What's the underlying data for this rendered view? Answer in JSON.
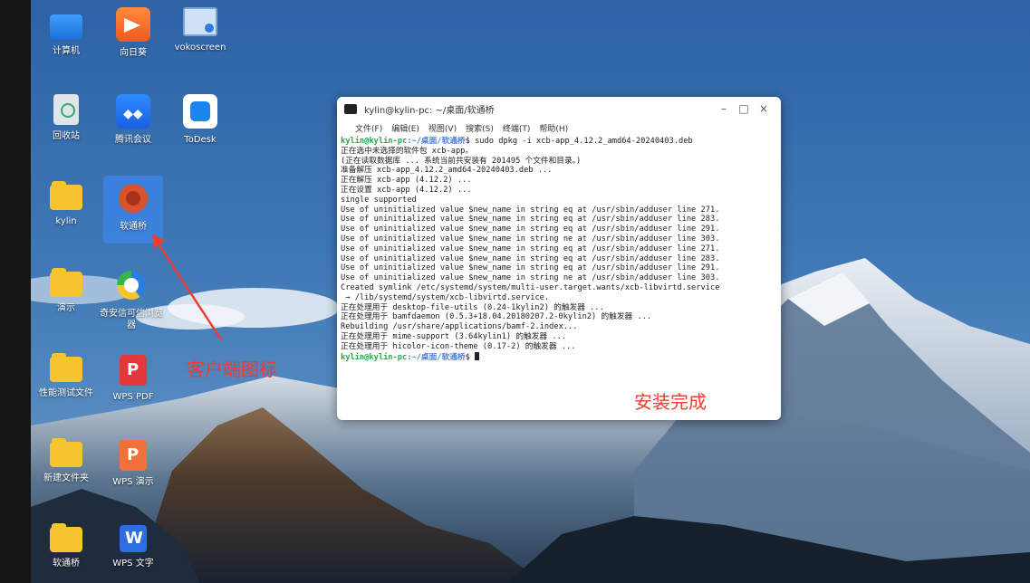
{
  "desktop": {
    "icons": [
      {
        "label": "计算机",
        "icon": "computer-icon"
      },
      {
        "label": "向日葵",
        "icon": "sunflower-icon"
      },
      {
        "label": "vokoscreen",
        "icon": "vokoscreen-icon"
      },
      {
        "label": "回收站",
        "icon": "trash-icon"
      },
      {
        "label": "腾讯会议",
        "icon": "tencent-meeting-icon"
      },
      {
        "label": "ToDesk",
        "icon": "todesk-icon"
      },
      {
        "label": "kylin",
        "icon": "folder-icon"
      },
      {
        "label": "软通桥",
        "icon": "ruantongqiao-icon"
      },
      {
        "label": "演示",
        "icon": "folder-icon"
      },
      {
        "label": "奇安信可信浏览器",
        "icon": "browser-icon"
      },
      {
        "label": "性能测试文件",
        "icon": "folder-icon"
      },
      {
        "label": "WPS PDF",
        "icon": "wps-pdf-icon"
      },
      {
        "label": "新建文件夹",
        "icon": "folder-icon"
      },
      {
        "label": "WPS 演示",
        "icon": "wps-presentation-icon"
      },
      {
        "label": "软通桥",
        "icon": "folder-icon"
      },
      {
        "label": "WPS 文字",
        "icon": "wps-writer-icon"
      }
    ],
    "colors": {
      "folder": "#f6c42e",
      "selection": "#3c8cff",
      "annotation": "#f23a2e"
    }
  },
  "annotations": {
    "client_icon": "客户端图标",
    "install_done": "安装完成"
  },
  "terminal": {
    "title": "kylin@kylin-pc: ~/桌面/软通桥",
    "controls": {
      "minimize": "–",
      "maximize": "□",
      "close": "×"
    },
    "menu": [
      "文件(F)",
      "编辑(E)",
      "视图(V)",
      "搜索(S)",
      "终端(T)",
      "帮助(H)"
    ],
    "prompt_user": "kylin@kylin-pc",
    "prompt_path": ":~/桌面/软通桥",
    "prompt_symbol": "$ ",
    "command": "sudo dpkg -i xcb-app_4.12.2_amd64-20240403.deb",
    "output": [
      "正在选中未选择的软件包 xcb-app。",
      "(正在读取数据库 ... 系统当前共安装有 201495 个文件和目录。)",
      "准备解压 xcb-app_4.12.2_amd64-20240403.deb ...",
      "正在解压 xcb-app (4.12.2) ...",
      "正在设置 xcb-app (4.12.2) ...",
      "single supported",
      "Use of uninitialized value $new_name in string eq at /usr/sbin/adduser line 271.",
      "Use of uninitialized value $new_name in string eq at /usr/sbin/adduser line 283.",
      "Use of uninitialized value $new_name in string eq at /usr/sbin/adduser line 291.",
      "Use of uninitialized value $new_name in string ne at /usr/sbin/adduser line 303.",
      "Use of uninitialized value $new_name in string eq at /usr/sbin/adduser line 271.",
      "Use of uninitialized value $new_name in string eq at /usr/sbin/adduser line 283.",
      "Use of uninitialized value $new_name in string eq at /usr/sbin/adduser line 291.",
      "Use of uninitialized value $new_name in string ne at /usr/sbin/adduser line 303.",
      "Created symlink /etc/systemd/system/multi-user.target.wants/xcb-libvirtd.service",
      " → /lib/systemd/system/xcb-libvirtd.service.",
      "正在处理用于 desktop-file-utils (0.24-1kylin2) 的触发器 ...",
      "正在处理用于 bamfdaemon (0.5.3+18.04.20180207.2-0kylin2) 的触发器 ...",
      "Rebuilding /usr/share/applications/bamf-2.index...",
      "正在处理用于 mime-support (3.64kylin1) 的触发器 ...",
      "正在处理用于 hicolor-icon-theme (0.17-2) 的触发器 ..."
    ]
  }
}
